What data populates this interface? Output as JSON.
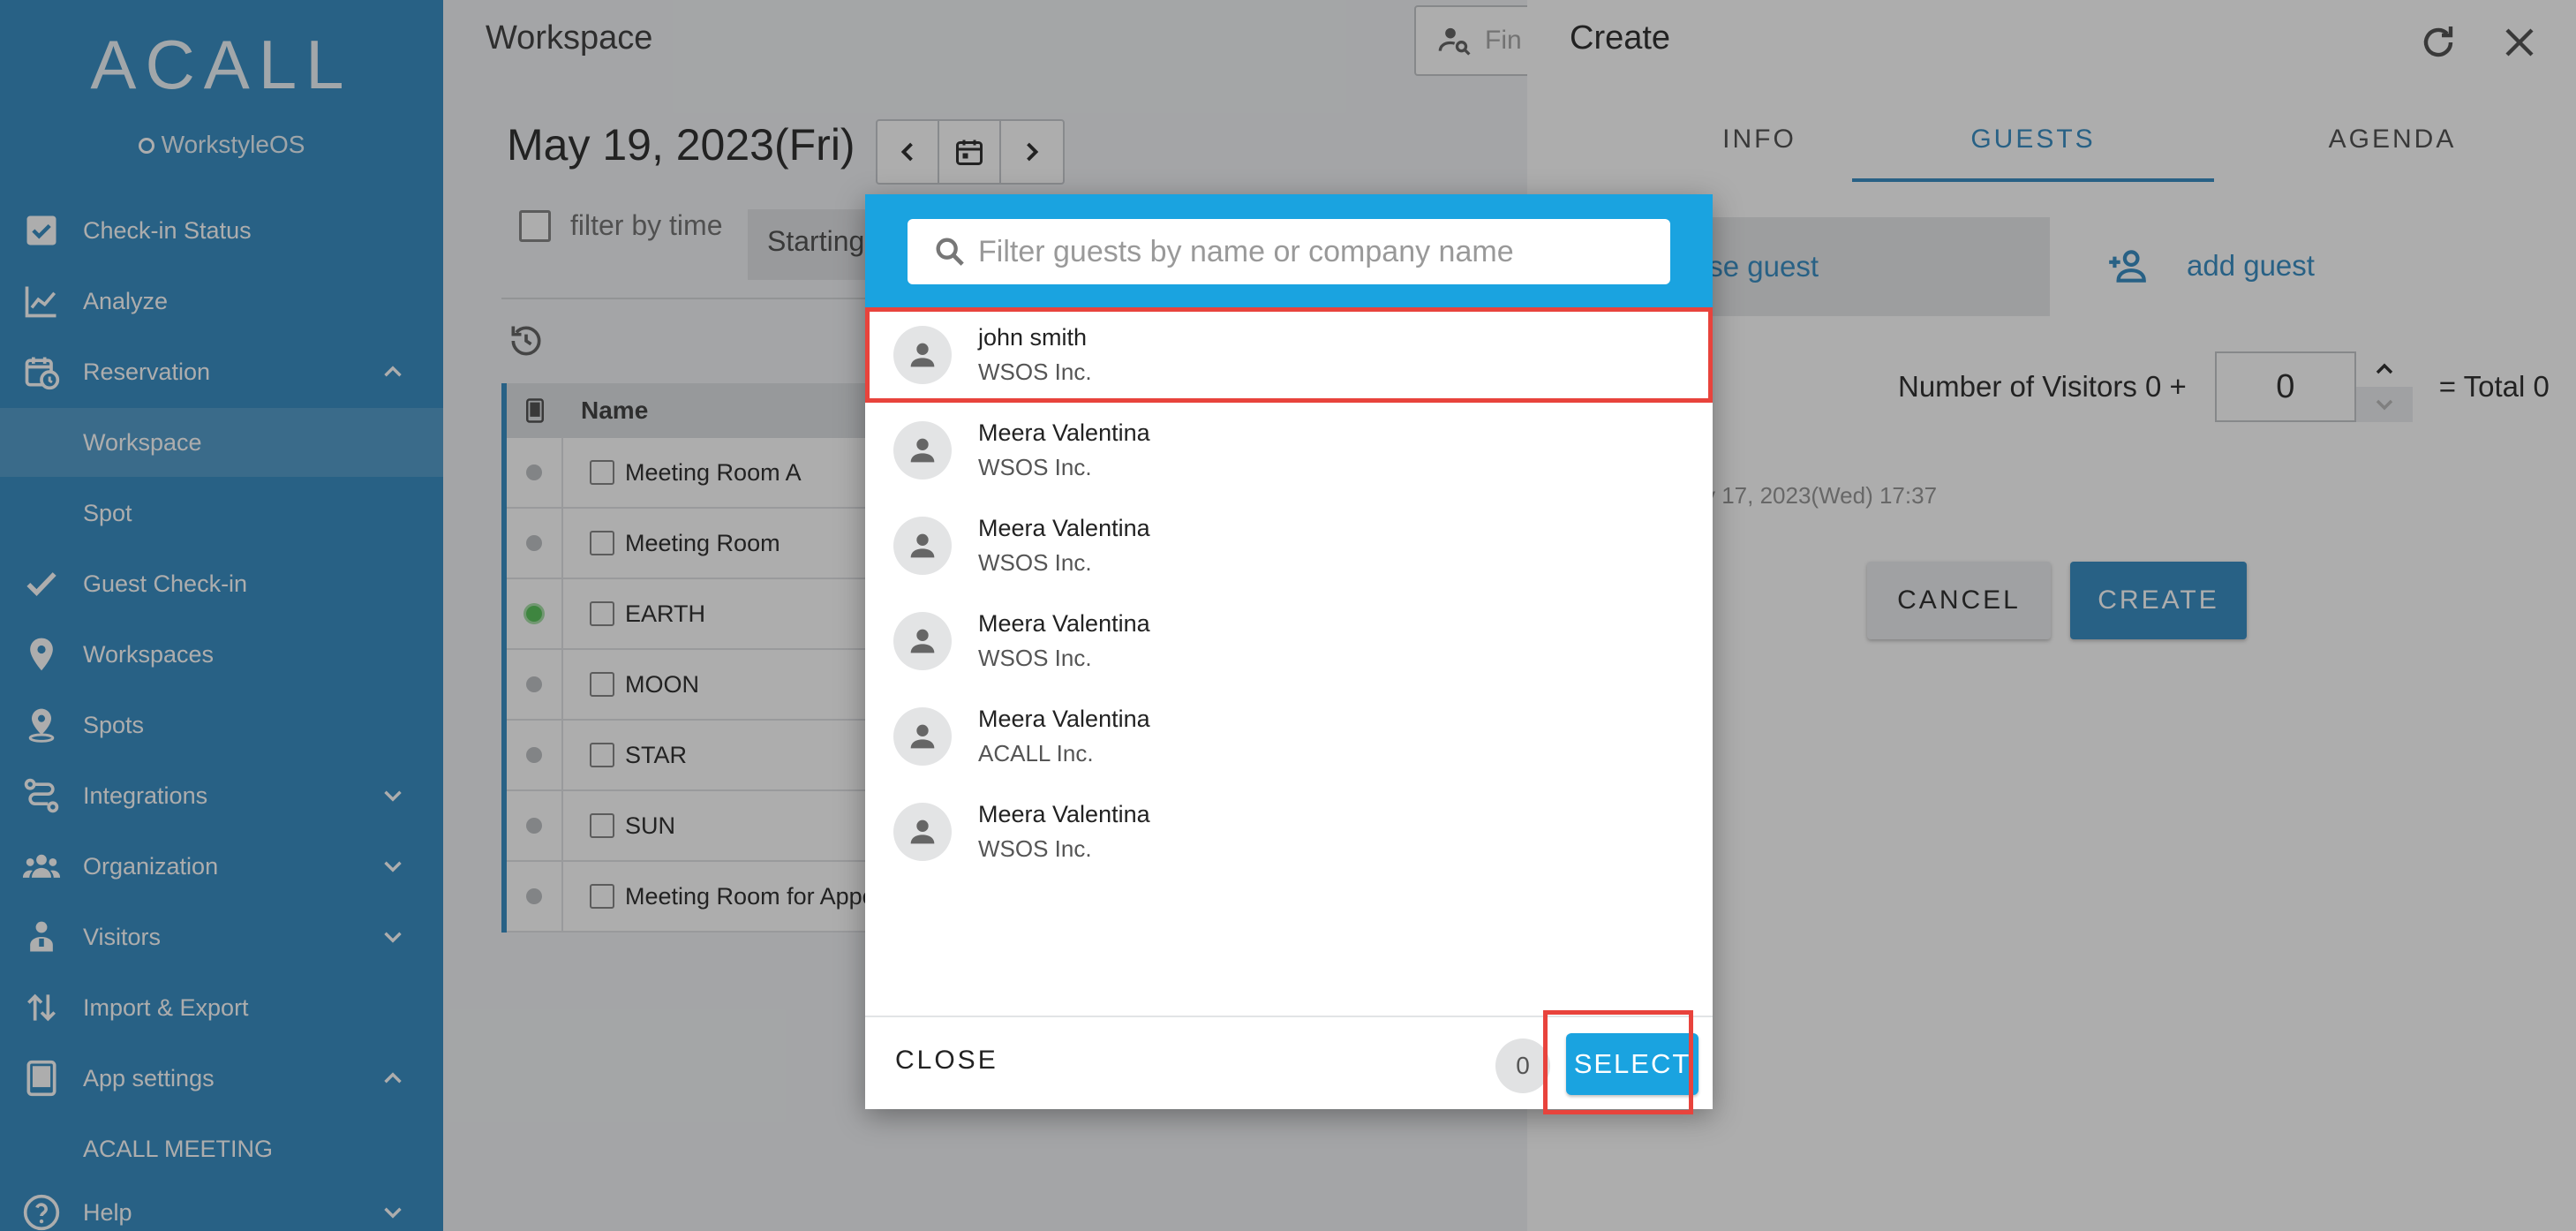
{
  "sidebar": {
    "logo": "ACALL",
    "product": "WorkstyleOS",
    "items": [
      {
        "label": "Check-in Status"
      },
      {
        "label": "Analyze"
      },
      {
        "label": "Reservation"
      },
      {
        "label": "Guest Check-in"
      },
      {
        "label": "Workspaces"
      },
      {
        "label": "Spots"
      },
      {
        "label": "Integrations"
      },
      {
        "label": "Organization"
      },
      {
        "label": "Visitors"
      },
      {
        "label": "Import & Export"
      },
      {
        "label": "App settings"
      },
      {
        "label": "Help"
      }
    ],
    "sub_items": {
      "workspace": "Workspace",
      "spot": "Spot",
      "acall_meeting": "ACALL MEETING"
    }
  },
  "main": {
    "title": "Workspace",
    "find_placeholder": "Fin",
    "date": "May 19, 2023(Fri)",
    "filter_label": "filter by time",
    "starting_label": "Starting",
    "table_header_name": "Name",
    "rooms": [
      {
        "name": "Meeting Room A",
        "status": "idle"
      },
      {
        "name": "Meeting Room",
        "status": "idle"
      },
      {
        "name": "EARTH",
        "status": "active"
      },
      {
        "name": "MOON",
        "status": "idle"
      },
      {
        "name": "STAR",
        "status": "idle"
      },
      {
        "name": "SUN",
        "status": "idle"
      },
      {
        "name": "Meeting Room for Appo",
        "status": "idle"
      }
    ]
  },
  "panel": {
    "title": "Create",
    "tabs": [
      "INFO",
      "GUESTS",
      "AGENDA"
    ],
    "active_tab": "GUESTS",
    "choose_guest": "se guest",
    "add_guest": "add guest",
    "visitors_label": "Number of Visitors 0 +",
    "visitors_value": "0",
    "total_label": "= Total 0",
    "date_small": "y 17, 2023(Wed) 17:37",
    "cancel": "CANCEL",
    "create": "CREATE"
  },
  "modal": {
    "search_placeholder": "Filter guests by name or company name",
    "guests": [
      {
        "name": "john smith",
        "company": "WSOS Inc."
      },
      {
        "name": "Meera Valentina",
        "company": "WSOS Inc."
      },
      {
        "name": "Meera Valentina",
        "company": "WSOS Inc."
      },
      {
        "name": "Meera Valentina",
        "company": "WSOS Inc."
      },
      {
        "name": "Meera Valentina",
        "company": "ACALL Inc."
      },
      {
        "name": "Meera Valentina",
        "company": "WSOS Inc."
      }
    ],
    "close": "CLOSE",
    "selected_count": "0",
    "select": "SELECT"
  },
  "colors": {
    "sidebar": "#3b8fc4",
    "accent": "#1aa3e0",
    "highlight": "#e8433c"
  }
}
